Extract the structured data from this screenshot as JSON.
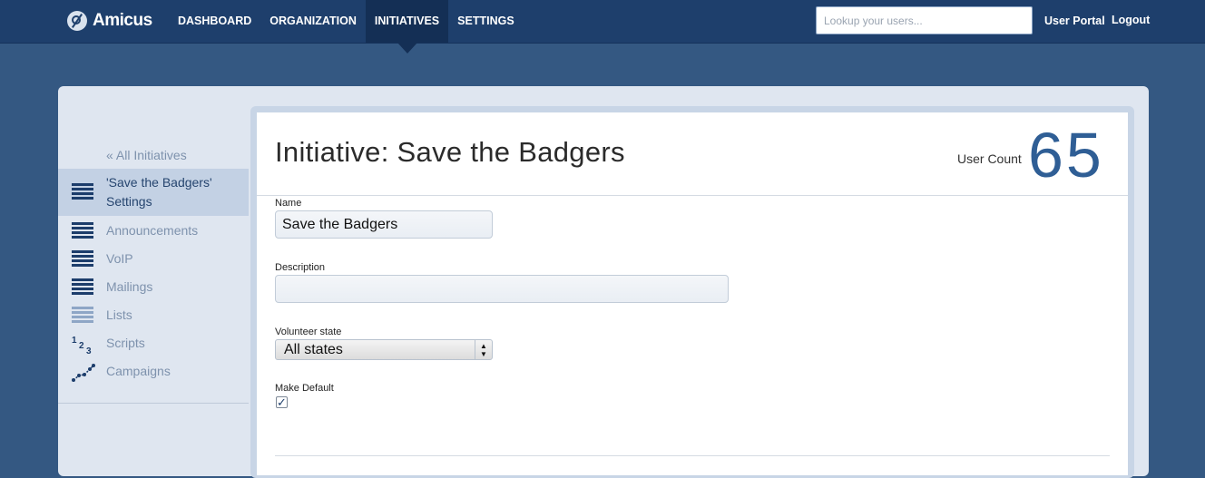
{
  "app": {
    "name": "Amicus"
  },
  "nav": {
    "items": [
      {
        "label": "DASHBOARD"
      },
      {
        "label": "ORGANIZATION"
      },
      {
        "label": "INITIATIVES"
      },
      {
        "label": "SETTINGS"
      }
    ],
    "active": "INITIATIVES"
  },
  "search": {
    "placeholder": "Lookup your users..."
  },
  "header_links": {
    "user_portal": "User Portal",
    "logout": "Logout"
  },
  "sidebar": {
    "back_label": "« All Initiatives",
    "items": [
      {
        "label": "'Save the Badgers' Settings",
        "icon": "list-icon"
      },
      {
        "label": "Announcements",
        "icon": "list-icon"
      },
      {
        "label": "VoIP",
        "icon": "list-icon"
      },
      {
        "label": "Mailings",
        "icon": "list-icon"
      },
      {
        "label": "Lists",
        "icon": "list-icon"
      },
      {
        "label": "Scripts",
        "icon": "numbered-list-icon"
      },
      {
        "label": "Campaigns",
        "icon": "line-chart-icon"
      }
    ]
  },
  "main": {
    "title": "Initiative: Save the Badgers",
    "user_count_label": "User Count",
    "user_count_value": "65",
    "form": {
      "name_label": "Name",
      "name_value": "Save the Badgers",
      "description_label": "Description",
      "description_value": "",
      "volunteer_state_label": "Volunteer state",
      "volunteer_state_value": "All states",
      "make_default_label": "Make Default",
      "make_default_checked": true
    }
  },
  "colors": {
    "topbar": "#1e3f6c",
    "background": "#345882",
    "accent": "#2f5e95"
  }
}
